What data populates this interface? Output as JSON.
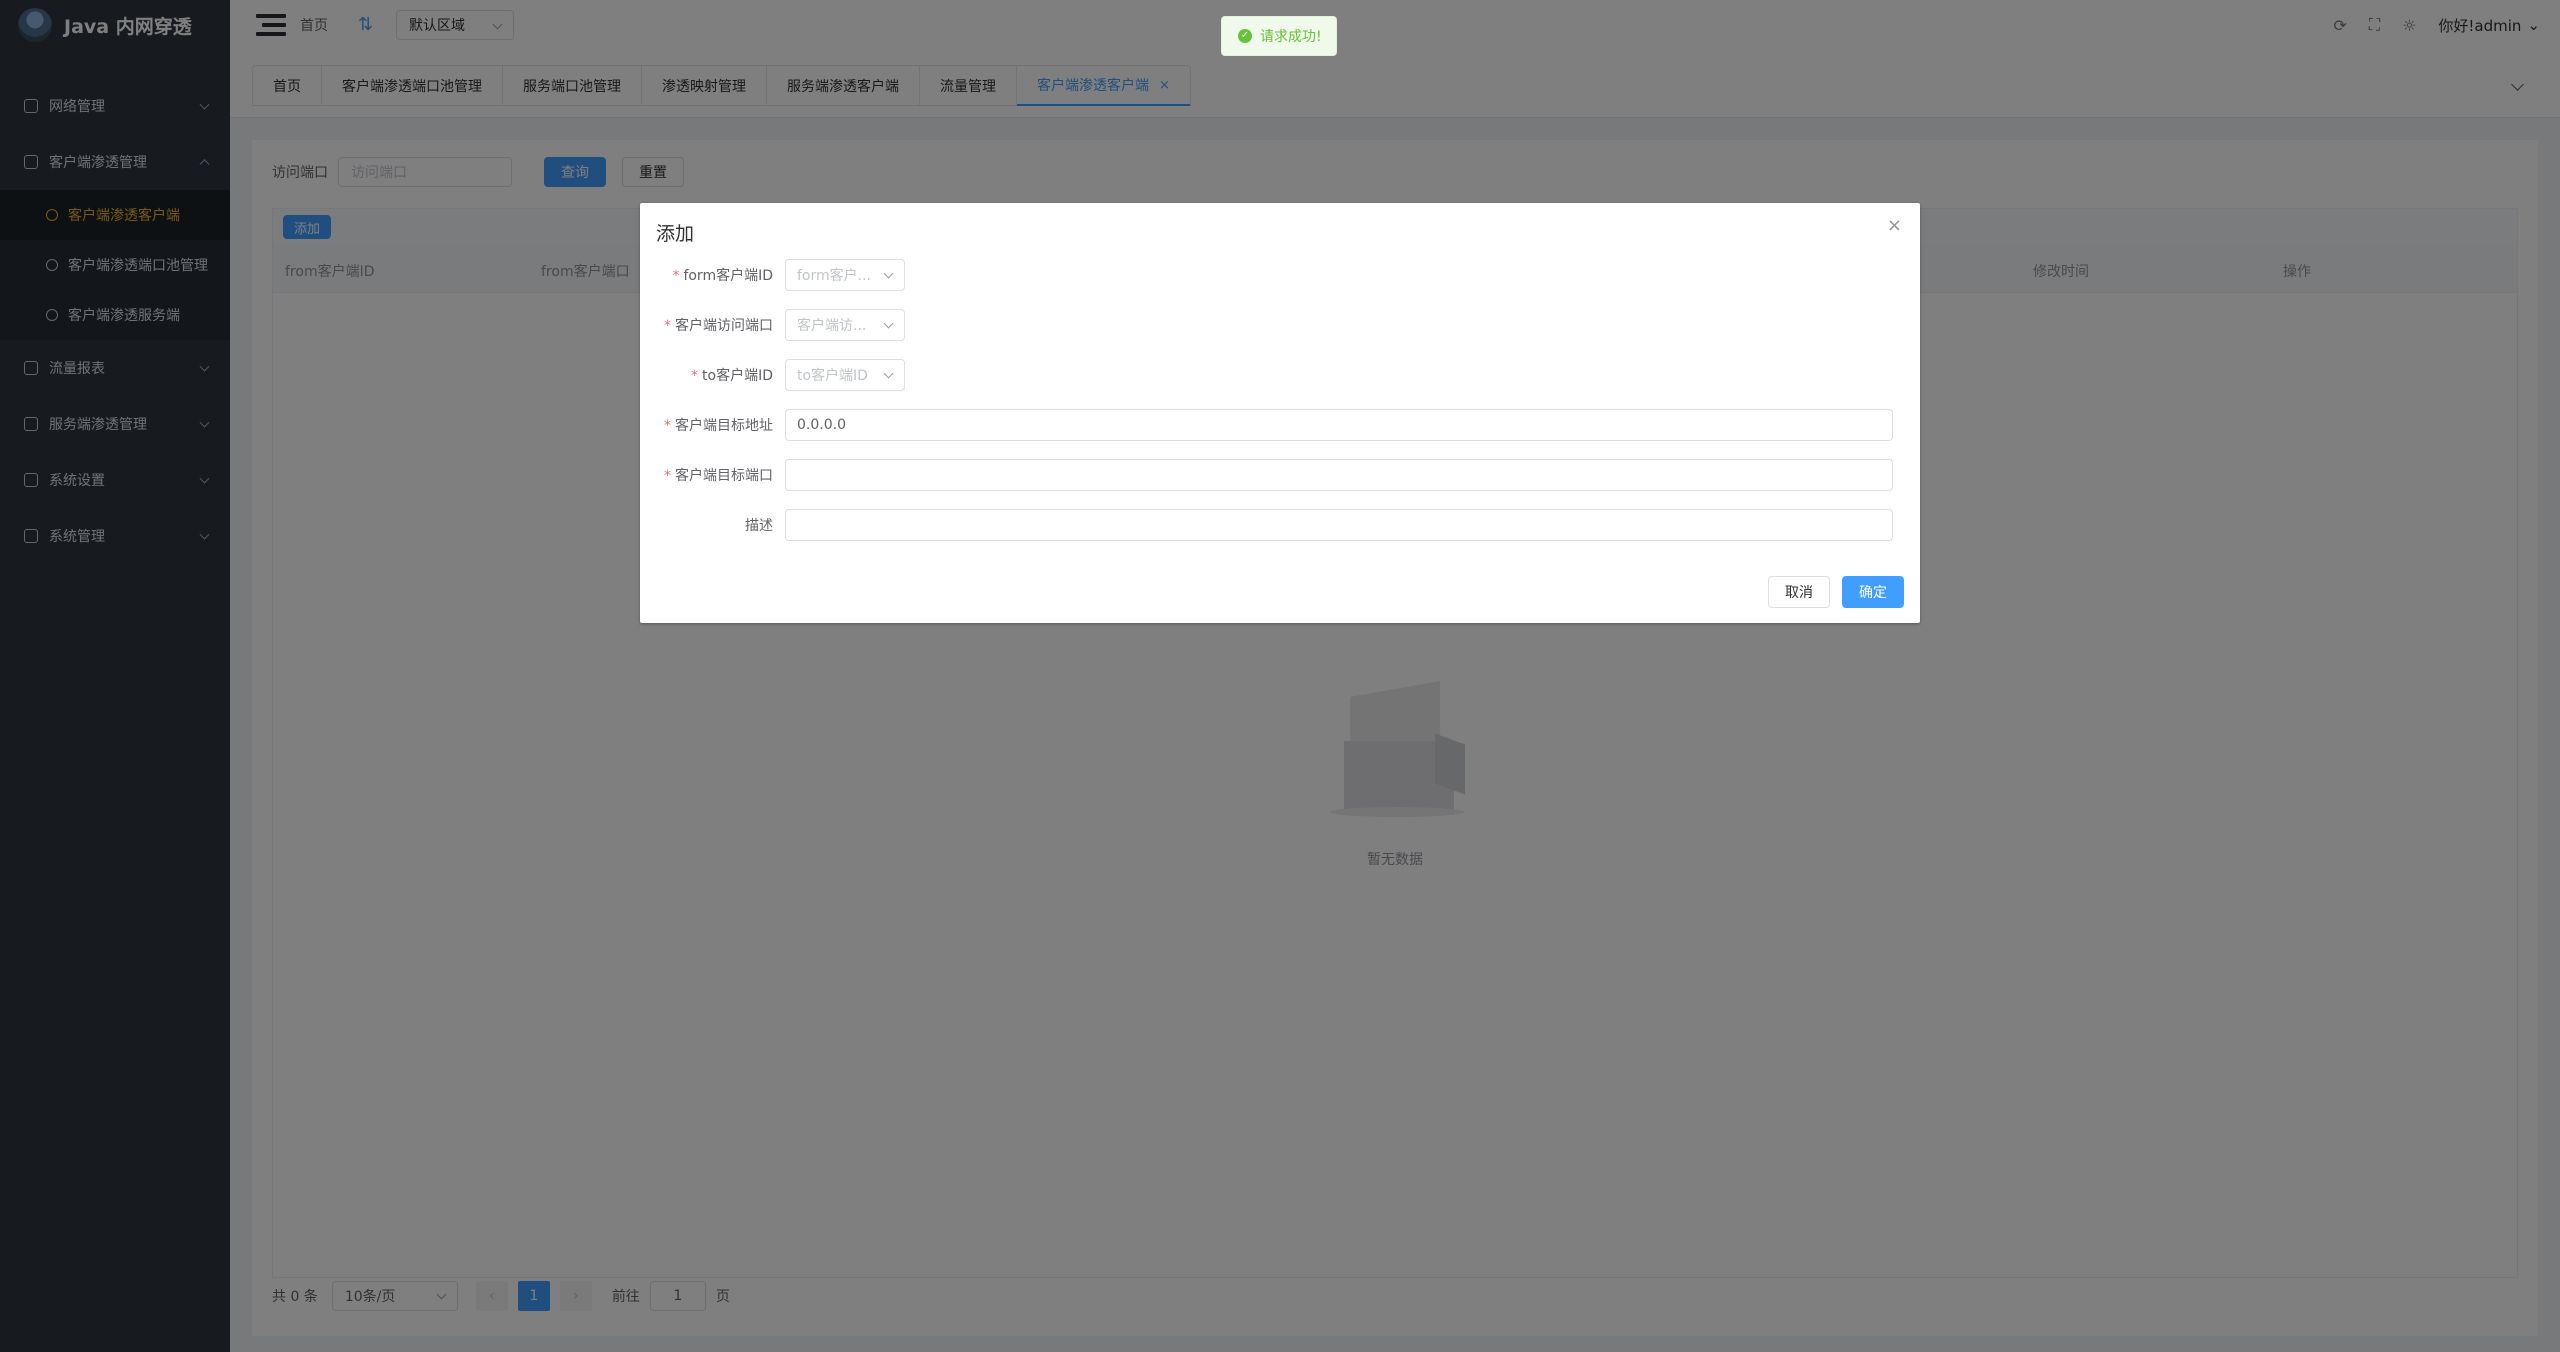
{
  "app": {
    "title": "Java 内网穿透"
  },
  "navbar": {
    "breadcrumb": "首页",
    "region": "默认区域",
    "user": "你好!admin"
  },
  "toast": {
    "message": "请求成功!"
  },
  "sidebar": {
    "items": [
      {
        "label": "网络管理"
      },
      {
        "label": "客户端渗透管理"
      },
      {
        "label": "客户端渗透客户端"
      },
      {
        "label": "客户端渗透端口池管理"
      },
      {
        "label": "客户端渗透服务端"
      },
      {
        "label": "流量报表"
      },
      {
        "label": "服务端渗透管理"
      },
      {
        "label": "系统设置"
      },
      {
        "label": "系统管理"
      }
    ]
  },
  "tags": [
    {
      "label": "首页"
    },
    {
      "label": "客户端渗透端口池管理"
    },
    {
      "label": "服务端口池管理"
    },
    {
      "label": "渗透映射管理"
    },
    {
      "label": "服务端渗透客户端"
    },
    {
      "label": "流量管理"
    },
    {
      "label": "客户端渗透客户端",
      "close": "×"
    }
  ],
  "search": {
    "label": "访问端口",
    "placeholder": "访问端口",
    "query_btn": "查询",
    "reset_btn": "重置"
  },
  "table": {
    "add_btn": "添加",
    "columns": [
      "from客户端ID",
      "from客户端口",
      "修改时间",
      "操作"
    ],
    "empty_text": "暂无数据"
  },
  "pagination": {
    "total": "共 0 条",
    "page_size": "10条/页",
    "prev": "‹",
    "current": "1",
    "next": "›",
    "goto_label": "前往",
    "goto_value": "1",
    "page_suffix": "页"
  },
  "dialog": {
    "title": "添加",
    "close": "×",
    "fields": [
      {
        "label": "form客户端ID",
        "placeholder": "form客户..."
      },
      {
        "label": "客户端访问端口",
        "placeholder": "客户端访..."
      },
      {
        "label": "to客户端ID",
        "placeholder": "to客户端ID"
      },
      {
        "label": "客户端目标地址",
        "value": "0.0.0.0"
      },
      {
        "label": "客户端目标端口",
        "value": ""
      },
      {
        "label": "描述",
        "value": ""
      }
    ],
    "required_mark": "*",
    "cancel": "取消",
    "confirm": "确定"
  }
}
